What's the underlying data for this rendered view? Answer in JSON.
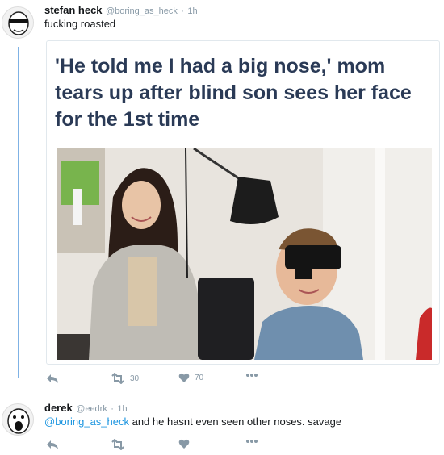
{
  "tweet1": {
    "name": "stefan heck",
    "handle": "@boring_as_heck",
    "time": "1h",
    "text": "fucking roasted",
    "card": {
      "headline": "'He told me I had a big nose,' mom tears up after blind son sees her face for the 1st time"
    },
    "actions": {
      "retweets": "30",
      "likes": "70"
    }
  },
  "tweet2": {
    "name": "derek",
    "handle": "@eedrk",
    "time": "1h",
    "mention": "@boring_as_heck",
    "text": " and he hasnt even seen other noses. savage"
  },
  "icons": {
    "reply": "reply-icon",
    "retweet": "retweet-icon",
    "like": "heart-icon",
    "more": "more-icon"
  },
  "colors": {
    "thread": "#7fb2e5",
    "mention": "#1b95e0",
    "muted": "#8899a6",
    "headline": "#2a3a56"
  }
}
